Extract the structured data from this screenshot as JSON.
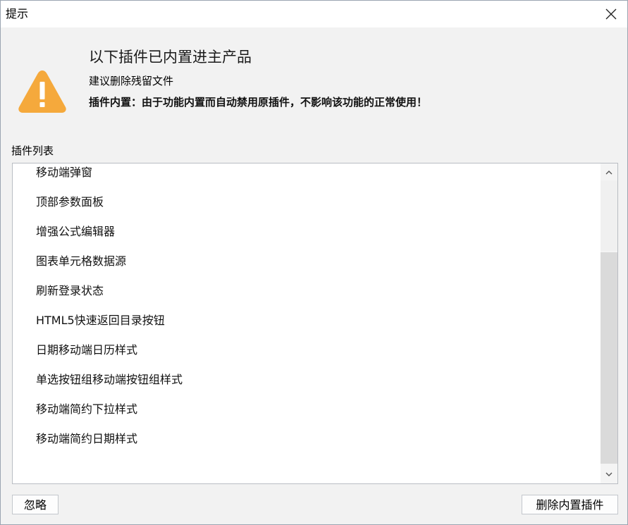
{
  "window": {
    "title": "提示"
  },
  "message": {
    "heading": "以下插件已内置进主产品",
    "subheading": "建议删除残留文件",
    "note": "插件内置：由于功能内置而自动禁用原插件，不影响该功能的正常使用！"
  },
  "plugin_list": {
    "label": "插件列表",
    "items": [
      "移动端弹窗",
      "顶部参数面板",
      "增强公式编辑器",
      "图表单元格数据源",
      "刷新登录状态",
      "HTML5快速返回目录按钮",
      "日期移动端日历样式",
      "单选按钮组移动端按钮组样式",
      "移动端简约下拉样式",
      "移动端简约日期样式"
    ]
  },
  "buttons": {
    "ignore": "忽略",
    "delete_builtin": "删除内置插件"
  },
  "icons": {
    "warning": "warning-triangle-icon",
    "close": "close-icon",
    "scroll_up": "chevron-up-icon",
    "scroll_down": "chevron-down-icon"
  },
  "colors": {
    "warning": "#f5a93c"
  }
}
